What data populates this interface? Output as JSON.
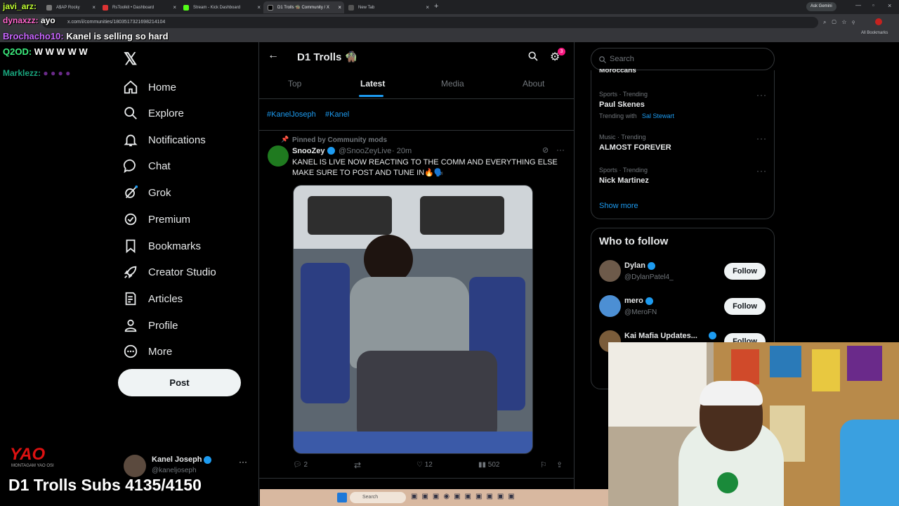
{
  "browser": {
    "tabs": [
      {
        "label": "A$AP Rocky"
      },
      {
        "label": "RsToolkit • Dashboard"
      },
      {
        "label": "Stream - Kick Dashboard"
      },
      {
        "label": "D1 Trolls 🧌 Community / X"
      },
      {
        "label": "New Tab"
      }
    ],
    "url": "x.com/i/communities/1803517321698214104",
    "ask_gemini": "Ask Gemini",
    "all_bookmarks": "All Bookmarks"
  },
  "chat": [
    {
      "user": "javi_arz:",
      "msg": "",
      "color": "#c0ff33"
    },
    {
      "user": "dynaxzz:",
      "msg": "ayo",
      "color": "#ff66cc"
    },
    {
      "user": "Brochacho10:",
      "msg": "Kanel is selling so hard",
      "color": "#c966ff"
    },
    {
      "user": "Q2OD:",
      "msg": "W W W W W",
      "color": "#3cf07f"
    },
    {
      "user": "Marklezz:",
      "msg": "",
      "color": "#19a67e"
    }
  ],
  "nav": {
    "items": [
      {
        "label": "Home",
        "icon": "home-icon"
      },
      {
        "label": "Explore",
        "icon": "search-icon"
      },
      {
        "label": "Notifications",
        "icon": "bell-icon"
      },
      {
        "label": "Chat",
        "icon": "chat-icon"
      },
      {
        "label": "Grok",
        "icon": "grok-icon"
      },
      {
        "label": "Premium",
        "icon": "premium-icon"
      },
      {
        "label": "Bookmarks",
        "icon": "bookmark-icon"
      },
      {
        "label": "Creator Studio",
        "icon": "rocket-icon"
      },
      {
        "label": "Articles",
        "icon": "articles-icon"
      },
      {
        "label": "Profile",
        "icon": "profile-icon"
      },
      {
        "label": "More",
        "icon": "more-icon"
      }
    ],
    "post_label": "Post",
    "account": {
      "name": "Kanel Joseph",
      "handle": "@kaneljoseph"
    }
  },
  "community": {
    "title": "D1 Trolls 🧌",
    "settings_badge": "3",
    "tabs": [
      "Top",
      "Latest",
      "Media",
      "About"
    ],
    "active_tab": "Latest",
    "hashtags": [
      "#KanelJoseph",
      "#Kanel"
    ]
  },
  "post": {
    "pinned_label": "Pinned by Community mods",
    "author": "SnooZey",
    "handle": "@SnooZeyLive",
    "time": "· 20m",
    "text": "KANEL IS LIVE NOW REACTING TO THE COMM AND EVERYTHING ELSE MAKE SURE TO POST AND TUNE IN🔥🗣️",
    "replies": "2",
    "likes": "12",
    "views": "502"
  },
  "sidebar": {
    "search_placeholder": "Search",
    "partial_trend": "Moroccans",
    "trends": [
      {
        "category": "Sports · Trending",
        "name": "Paul Skenes",
        "with_label": "Trending with",
        "with_name": "Sal Stewart"
      },
      {
        "category": "Music · Trending",
        "name": "ALMOST FOREVER"
      },
      {
        "category": "Sports · Trending",
        "name": "Nick Martinez"
      }
    ],
    "show_more": "Show more",
    "who_to_follow_title": "Who to follow",
    "follow_suggestions": [
      {
        "name": "Dylan",
        "handle": "@DylanPatel4_"
      },
      {
        "name": "mero",
        "handle": "@MeroFN"
      },
      {
        "name": "Kai Mafia Updates...",
        "handle": ""
      }
    ],
    "follow_label": "Follow"
  },
  "overlay": {
    "subs_text": "D1 Trolls Subs 4135/4150",
    "logo_text": "YAO",
    "logo_sub": "MONTAGAM YAO OSI"
  },
  "taskbar": {
    "search_placeholder": "Search"
  }
}
